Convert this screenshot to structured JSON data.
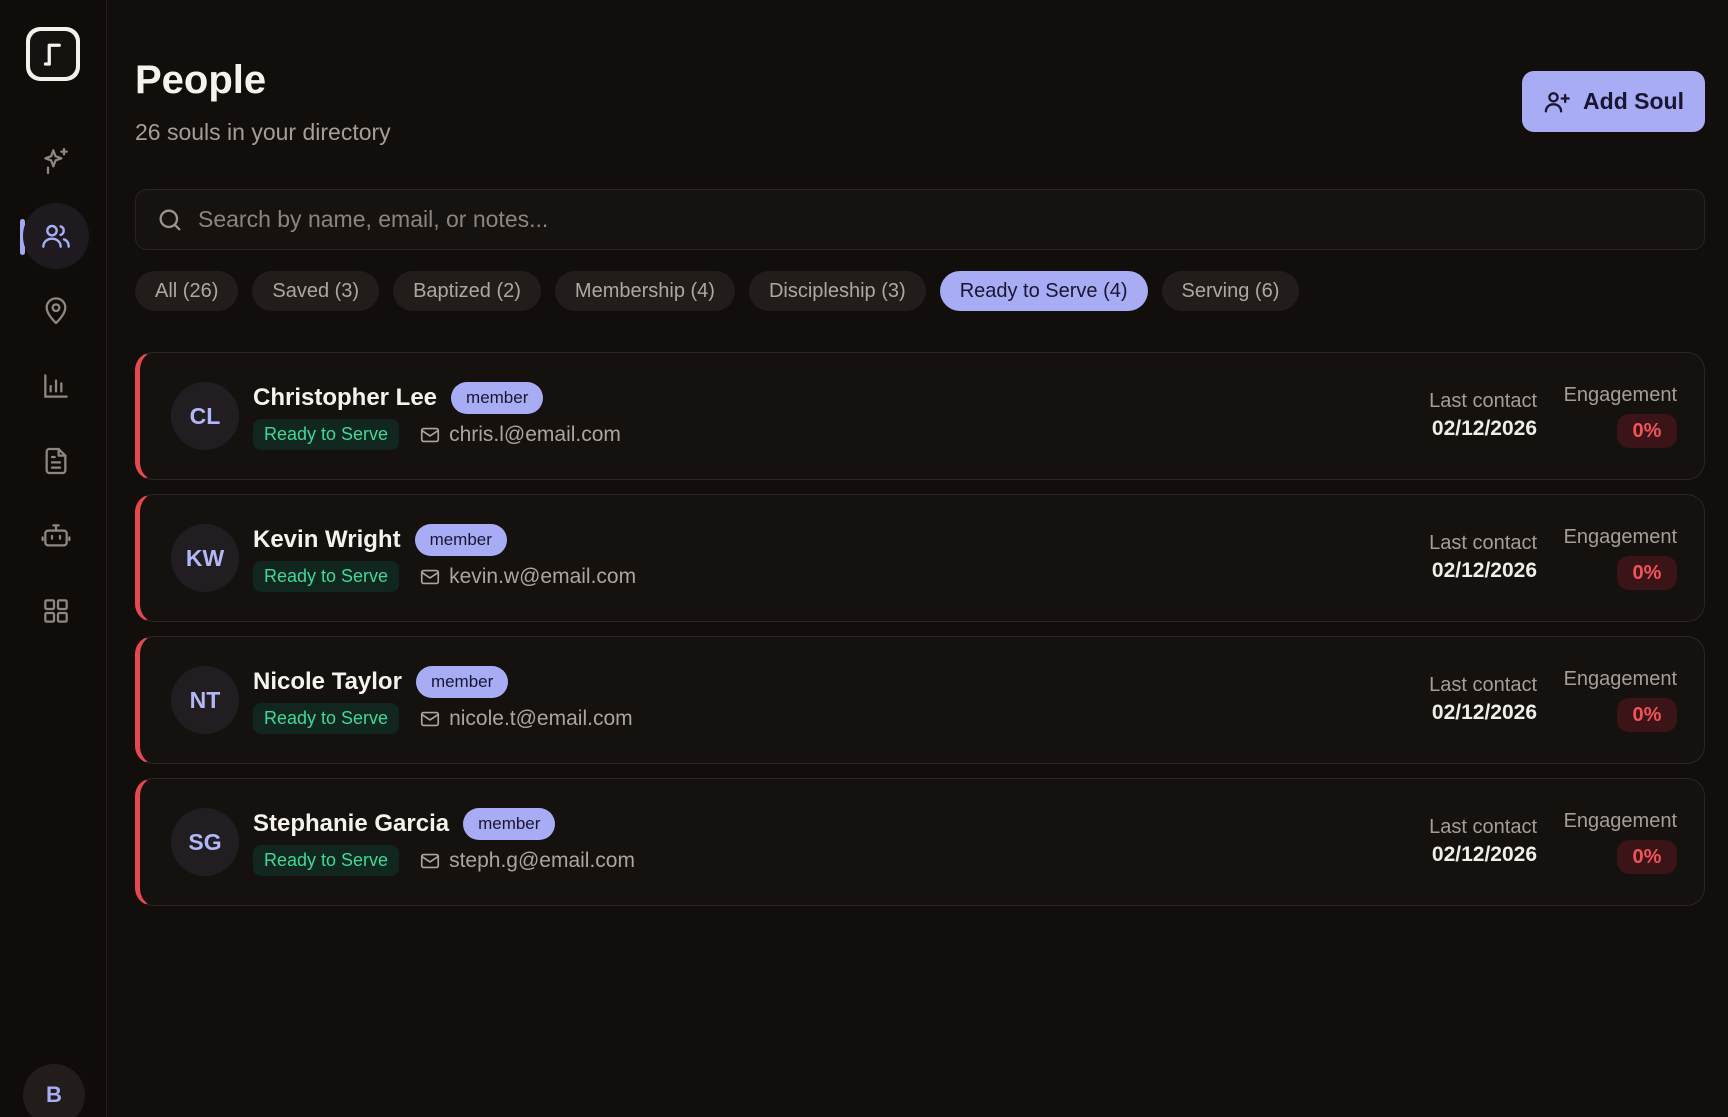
{
  "app": {
    "logo_icon": "music-note-logo-icon",
    "user_initial": "B"
  },
  "sidebar": {
    "items": [
      {
        "icon": "sparkles-icon",
        "active": false
      },
      {
        "icon": "users-icon",
        "active": true
      },
      {
        "icon": "map-pin-icon",
        "active": false
      },
      {
        "icon": "bar-chart-icon",
        "active": false
      },
      {
        "icon": "document-icon",
        "active": false
      },
      {
        "icon": "bot-icon",
        "active": false
      },
      {
        "icon": "grid-icon",
        "active": false
      }
    ]
  },
  "header": {
    "title": "People",
    "subtitle": "26 souls in your directory",
    "add_button_label": "Add Soul"
  },
  "search": {
    "placeholder": "Search by name, email, or notes...",
    "value": ""
  },
  "filters": [
    {
      "label": "All (26)",
      "active": false
    },
    {
      "label": "Saved (3)",
      "active": false
    },
    {
      "label": "Baptized (2)",
      "active": false
    },
    {
      "label": "Membership (4)",
      "active": false
    },
    {
      "label": "Discipleship (3)",
      "active": false
    },
    {
      "label": "Ready to Serve (4)",
      "active": true
    },
    {
      "label": "Serving (6)",
      "active": false
    }
  ],
  "people": [
    {
      "initials": "CL",
      "name": "Christopher Lee",
      "role": "member",
      "stage": "Ready to Serve",
      "email": "chris.l@email.com",
      "last_contact_label": "Last contact",
      "last_contact": "02/12/2026",
      "engagement_label": "Engagement",
      "engagement": "0%"
    },
    {
      "initials": "KW",
      "name": "Kevin Wright",
      "role": "member",
      "stage": "Ready to Serve",
      "email": "kevin.w@email.com",
      "last_contact_label": "Last contact",
      "last_contact": "02/12/2026",
      "engagement_label": "Engagement",
      "engagement": "0%"
    },
    {
      "initials": "NT",
      "name": "Nicole Taylor",
      "role": "member",
      "stage": "Ready to Serve",
      "email": "nicole.t@email.com",
      "last_contact_label": "Last contact",
      "last_contact": "02/12/2026",
      "engagement_label": "Engagement",
      "engagement": "0%"
    },
    {
      "initials": "SG",
      "name": "Stephanie Garcia",
      "role": "member",
      "stage": "Ready to Serve",
      "email": "steph.g@email.com",
      "last_contact_label": "Last contact",
      "last_contact": "02/12/2026",
      "engagement_label": "Engagement",
      "engagement": "0%"
    }
  ],
  "colors": {
    "accent": "#a7acf4",
    "background": "#120e0c",
    "stage_green": "#3fd99a",
    "alert_red": "#e5484d"
  }
}
